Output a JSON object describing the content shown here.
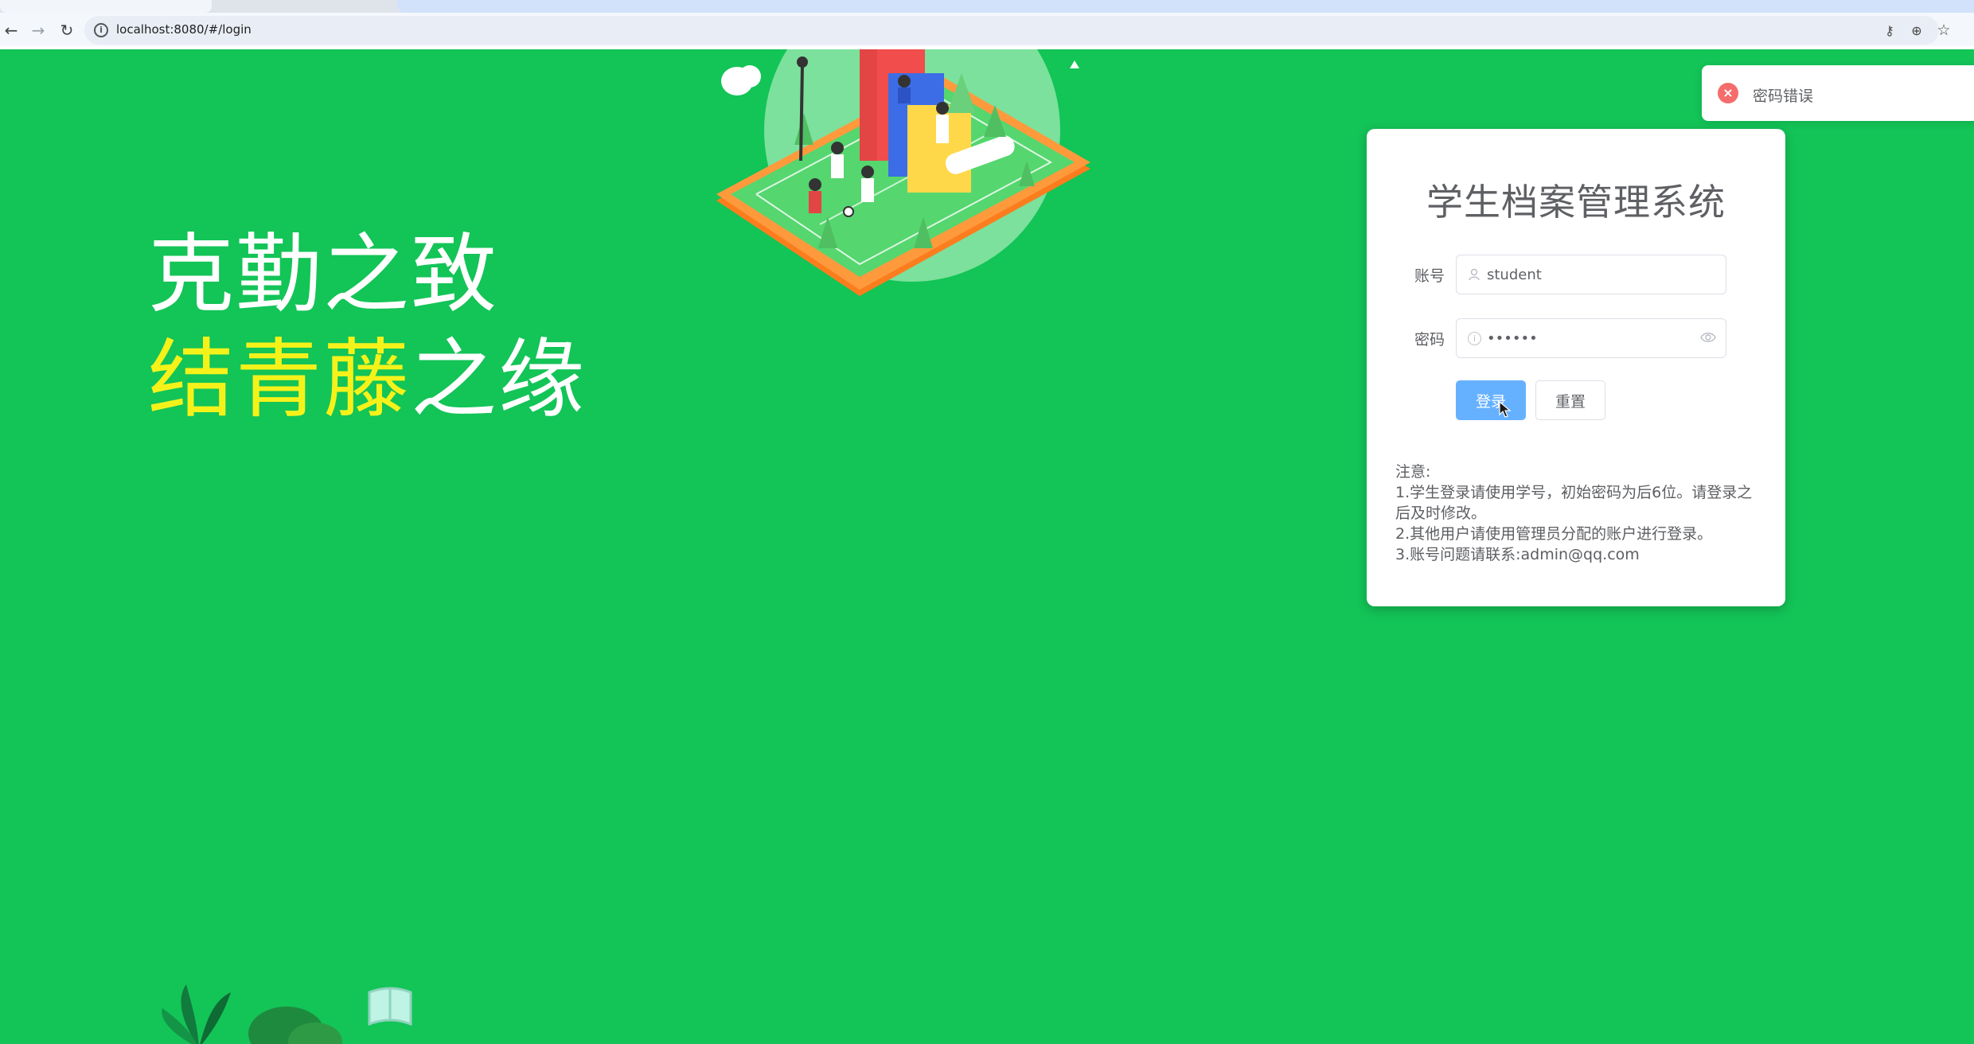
{
  "browser": {
    "url": "localhost:8080/#/login",
    "nav": {
      "back_icon": "←",
      "forward_icon": "→",
      "reload_icon": "↻"
    },
    "icons": {
      "key": "⚷",
      "zoom": "⊕",
      "star": "☆"
    }
  },
  "slogan": {
    "line1": "克勤之致",
    "line2_highlight": "结青藤",
    "line2_rest": "之缘",
    "highlight_color": "#f5f21a"
  },
  "login": {
    "title": "学生档案管理系统",
    "account_label": "账号",
    "account_value": "student",
    "password_label": "密码",
    "password_value": "••••••",
    "login_button": "登录",
    "reset_button": "重置",
    "notes": [
      "注意:",
      "1.学生登录请使用学号，初始密码为后6位。请登录之后及时修改。",
      "2.其他用户请使用管理员分配的账户进行登录。",
      "3.账号问题请联系:admin@qq.com"
    ]
  },
  "toast": {
    "message": "密码错误",
    "type": "error",
    "icon": "×"
  },
  "colors": {
    "page_bg": "#13c457",
    "primary_button": "#66b1ff",
    "error": "#f56c6c"
  }
}
